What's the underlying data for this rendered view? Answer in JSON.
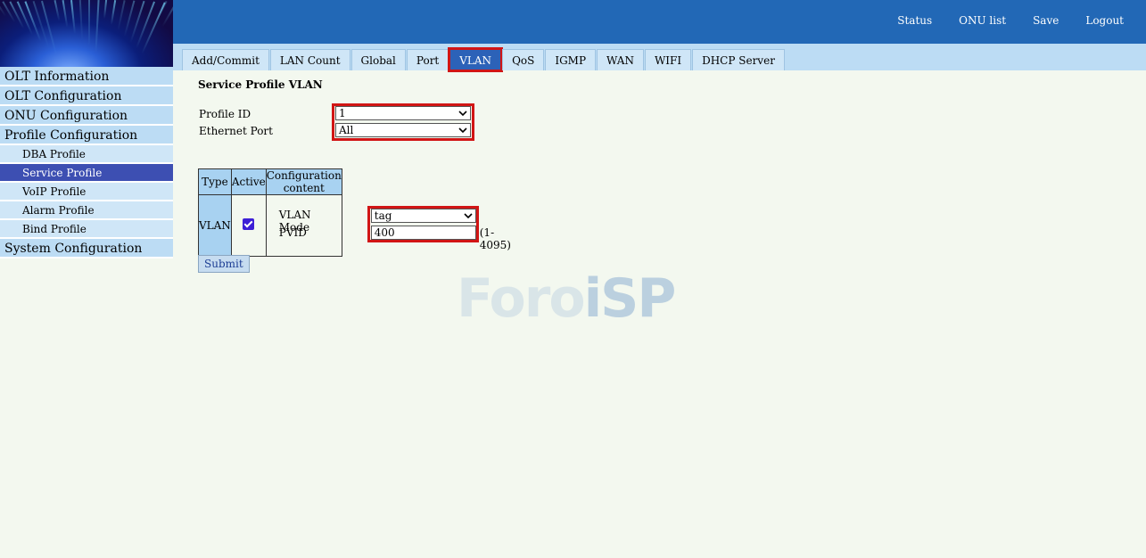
{
  "header": {
    "links": [
      "Status",
      "ONU list",
      "Save",
      "Logout"
    ]
  },
  "tabs": [
    "Add/Commit",
    "LAN Count",
    "Global",
    "Port",
    "VLAN",
    "QoS",
    "IGMP",
    "WAN",
    "WIFI",
    "DHCP Server"
  ],
  "active_tab": "VLAN",
  "sidebar": {
    "items": [
      {
        "label": "OLT Information",
        "level": "main"
      },
      {
        "label": "OLT Configuration",
        "level": "main"
      },
      {
        "label": "ONU Configuration",
        "level": "main"
      },
      {
        "label": "Profile Configuration",
        "level": "main"
      },
      {
        "label": "DBA Profile",
        "level": "sub"
      },
      {
        "label": "Service Profile",
        "level": "sub",
        "active": true
      },
      {
        "label": "VoIP Profile",
        "level": "sub"
      },
      {
        "label": "Alarm Profile",
        "level": "sub"
      },
      {
        "label": "Bind Profile",
        "level": "sub"
      },
      {
        "label": "System Configuration",
        "level": "main"
      }
    ]
  },
  "main": {
    "title": "Service Profile VLAN",
    "profile_id_label": "Profile ID",
    "profile_id_value": "1",
    "ethernet_port_label": "Ethernet Port",
    "ethernet_port_value": "All",
    "table": {
      "headers": [
        "Type",
        "Active",
        "Configuration content"
      ],
      "row_type": "VLAN",
      "active_checked": true,
      "vlan_mode_label": "VLAN Mode",
      "vlan_mode_value": "tag",
      "pvid_label": "PVID",
      "pvid_value": "400",
      "pvid_range": "(1-4095)"
    },
    "submit_label": "Submit"
  },
  "watermark": {
    "left_text": "Foro",
    "right_text": "iSP"
  },
  "colors": {
    "header_blue": "#2268b6",
    "tab_strip": "#bcdcf4",
    "active_nav": "#3d4fb2",
    "highlight_red": "#d11515",
    "page_bg": "#f3f8ef"
  }
}
